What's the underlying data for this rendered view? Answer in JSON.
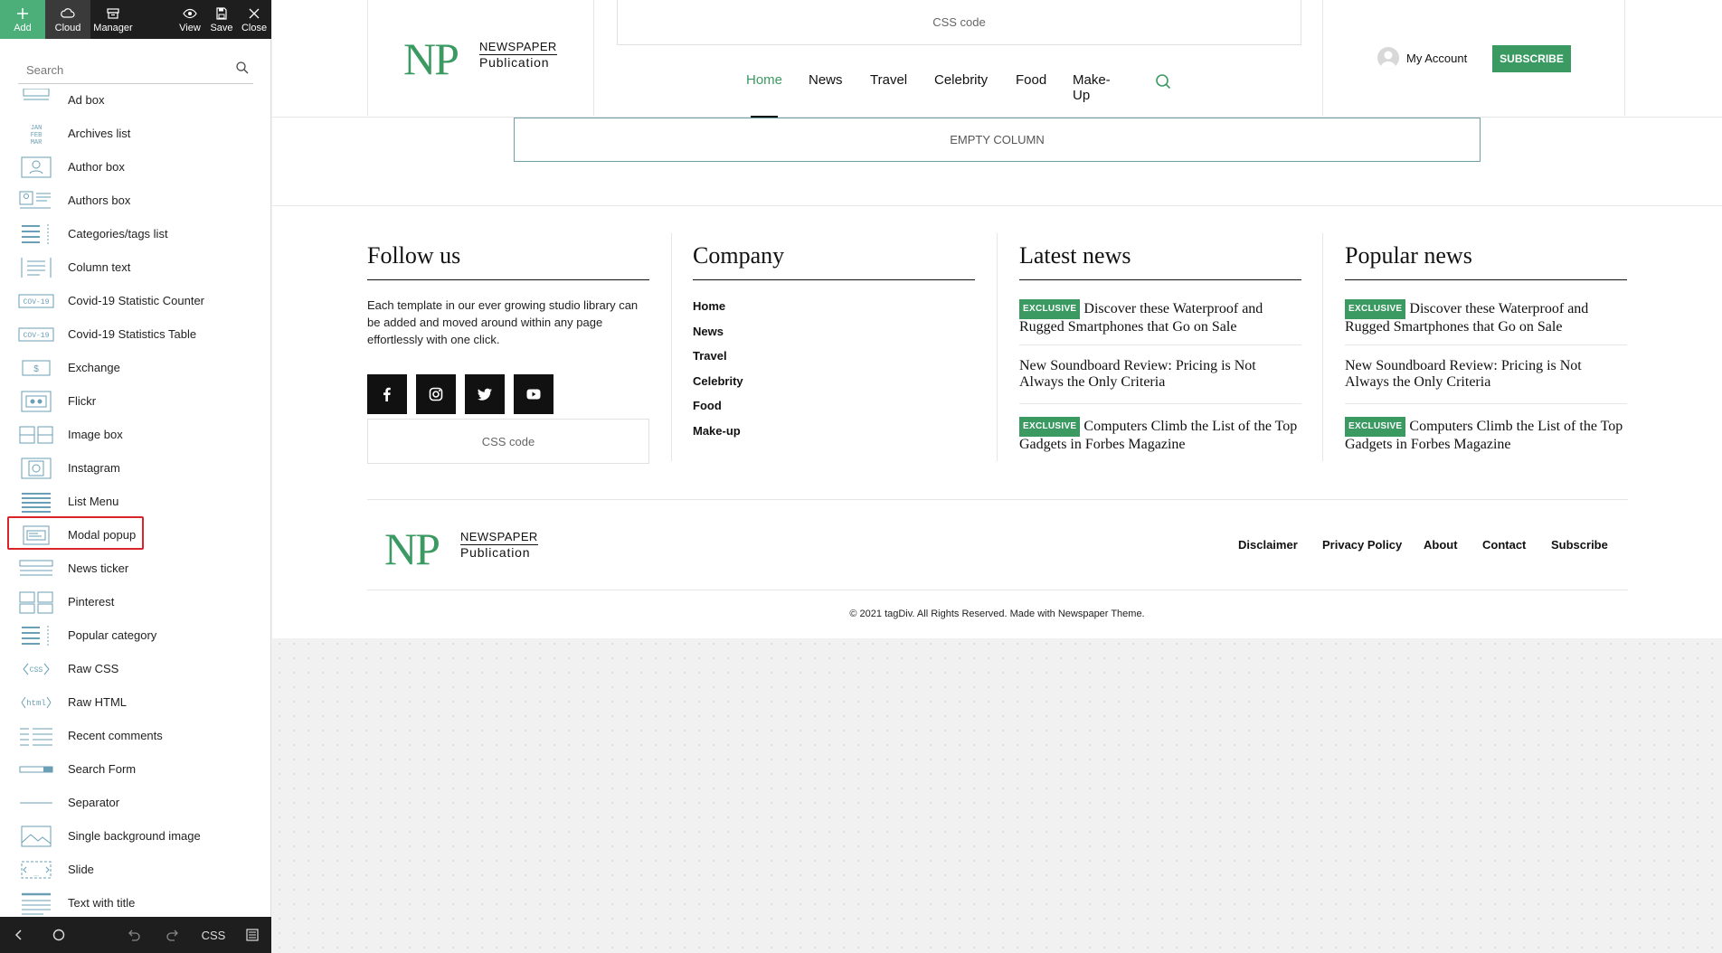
{
  "toolbar": {
    "add_label": "Add",
    "cloud_label": "Cloud",
    "manager_label": "Manager",
    "view_label": "View",
    "save_label": "Save",
    "close_label": "Close"
  },
  "search": {
    "placeholder": "Search"
  },
  "elements": [
    {
      "label": "Ad box",
      "icon": "ad-box-icon"
    },
    {
      "label": "Archives list",
      "icon": "archives-list-icon",
      "icon_text": [
        "JAN",
        "FEB",
        "MAR"
      ]
    },
    {
      "label": "Author box",
      "icon": "author-box-icon"
    },
    {
      "label": "Authors box",
      "icon": "authors-box-icon"
    },
    {
      "label": "Categories/tags list",
      "icon": "categories-list-icon"
    },
    {
      "label": "Column text",
      "icon": "column-text-icon"
    },
    {
      "label": "Covid-19 Statistic Counter",
      "icon": "covid-counter-icon",
      "icon_text": "COV-19"
    },
    {
      "label": "Covid-19 Statistics Table",
      "icon": "covid-table-icon",
      "icon_text": "COV-19"
    },
    {
      "label": "Exchange",
      "icon": "exchange-icon"
    },
    {
      "label": "Flickr",
      "icon": "flickr-icon"
    },
    {
      "label": "Image box",
      "icon": "image-box-icon"
    },
    {
      "label": "Instagram",
      "icon": "instagram-icon"
    },
    {
      "label": "List Menu",
      "icon": "list-menu-icon"
    },
    {
      "label": "Modal popup",
      "icon": "modal-popup-icon",
      "highlighted": true
    },
    {
      "label": "News ticker",
      "icon": "news-ticker-icon"
    },
    {
      "label": "Pinterest",
      "icon": "pinterest-icon"
    },
    {
      "label": "Popular category",
      "icon": "popular-category-icon"
    },
    {
      "label": "Raw CSS",
      "icon": "raw-css-icon",
      "icon_text": "CSS"
    },
    {
      "label": "Raw HTML",
      "icon": "raw-html-icon",
      "icon_text": "html"
    },
    {
      "label": "Recent comments",
      "icon": "recent-comments-icon"
    },
    {
      "label": "Search Form",
      "icon": "search-form-icon"
    },
    {
      "label": "Separator",
      "icon": "separator-icon"
    },
    {
      "label": "Single background image",
      "icon": "background-image-icon"
    },
    {
      "label": "Slide",
      "icon": "slide-icon"
    },
    {
      "label": "Text with title",
      "icon": "text-with-title-icon"
    }
  ],
  "bottombar": {
    "css_label": "CSS"
  },
  "header": {
    "css_code": "CSS code",
    "logo": {
      "np": "NP",
      "line1": "NEWSPAPER",
      "line2": "Publication"
    },
    "nav": [
      "Home",
      "News",
      "Travel",
      "Celebrity",
      "Food",
      "Make-Up"
    ],
    "account": "My Account",
    "subscribe": "SUBSCRIBE"
  },
  "empty_column": "EMPTY COLUMN",
  "footer_cols": {
    "follow": {
      "title": "Follow us",
      "text": "Each template in our ever growing studio library can be added and moved around within any page effortlessly with one click.",
      "socials": [
        "facebook-icon",
        "instagram-icon",
        "twitter-icon",
        "youtube-icon"
      ],
      "css_code": "CSS code"
    },
    "company": {
      "title": "Company",
      "links": [
        "Home",
        "News",
        "Travel",
        "Celebrity",
        "Food",
        "Make-up"
      ]
    },
    "latest": {
      "title": "Latest news",
      "items": [
        {
          "badge": "EXCLUSIVE",
          "title": "Discover these Waterproof and Rugged Smartphones that Go on Sale"
        },
        {
          "badge": "",
          "title": "New Soundboard Review: Pricing is Not Always the Only Criteria"
        },
        {
          "badge": "EXCLUSIVE",
          "title": "Computers Climb the List of the Top Gadgets in Forbes Magazine"
        }
      ]
    },
    "popular": {
      "title": "Popular news",
      "items": [
        {
          "badge": "EXCLUSIVE",
          "title": "Discover these Waterproof and Rugged Smartphones that Go on Sale"
        },
        {
          "badge": "",
          "title": "New Soundboard Review: Pricing is Not Always the Only Criteria"
        },
        {
          "badge": "EXCLUSIVE",
          "title": "Computers Climb the List of the Top Gadgets in Forbes Magazine"
        }
      ]
    }
  },
  "footer": {
    "links": [
      "Disclaimer",
      "Privacy Policy",
      "About",
      "Contact",
      "Subscribe"
    ],
    "copyright": "© 2021 tagDiv. All Rights Reserved. Made with Newspaper Theme."
  },
  "colors": {
    "accent": "#3b9a62",
    "toolbar": "#1e1e1e",
    "highlight": "#d9252a",
    "icon_stroke": "#6a9fb5"
  }
}
